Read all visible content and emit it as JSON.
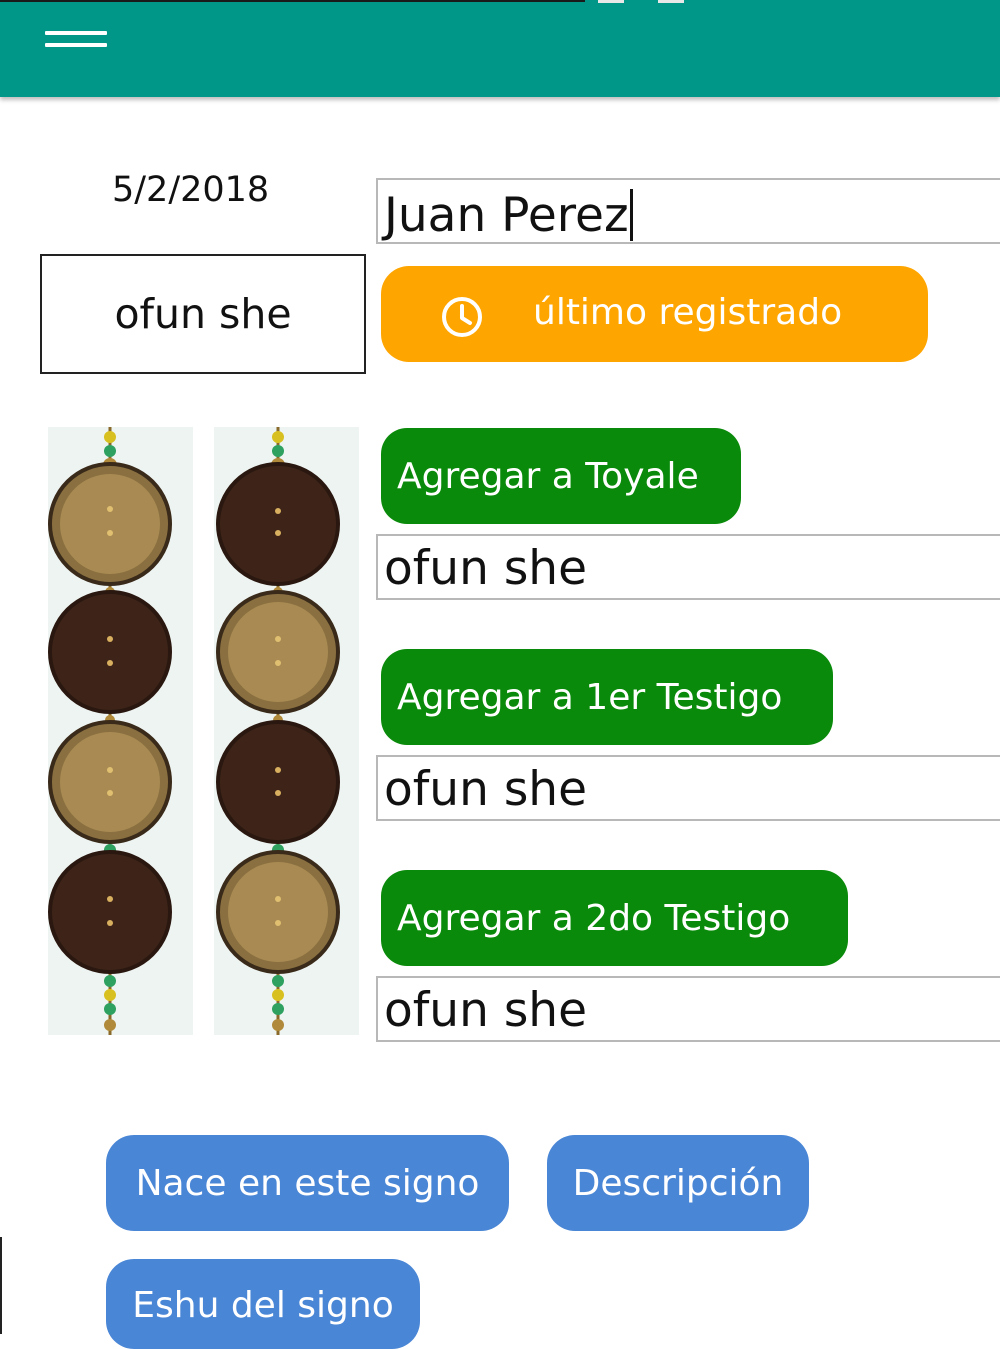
{
  "app_bar": {
    "color": "#009688",
    "menu_icon": "hamburger-menu-icon"
  },
  "header": {
    "date": "5/2/2018",
    "name_value": "Juan Perez"
  },
  "sign": {
    "current": "ofun she"
  },
  "last_registered": {
    "label": "último registrado",
    "icon": "clock-icon",
    "color": "#FFA500"
  },
  "assignments": [
    {
      "button_label": "Agregar a Toyale",
      "value": "ofun she"
    },
    {
      "button_label": "Agregar a 1er Testigo",
      "value": "ofun she"
    },
    {
      "button_label": "Agregar a 2do Testigo",
      "value": "ofun she"
    }
  ],
  "bead_chains": {
    "icon": "opele-chain-image"
  },
  "actions": {
    "nace_label": "Nace en este signo",
    "descripcion_label": "Descripción",
    "eshu_label": "Eshu del signo",
    "color": "#4A86D6"
  }
}
